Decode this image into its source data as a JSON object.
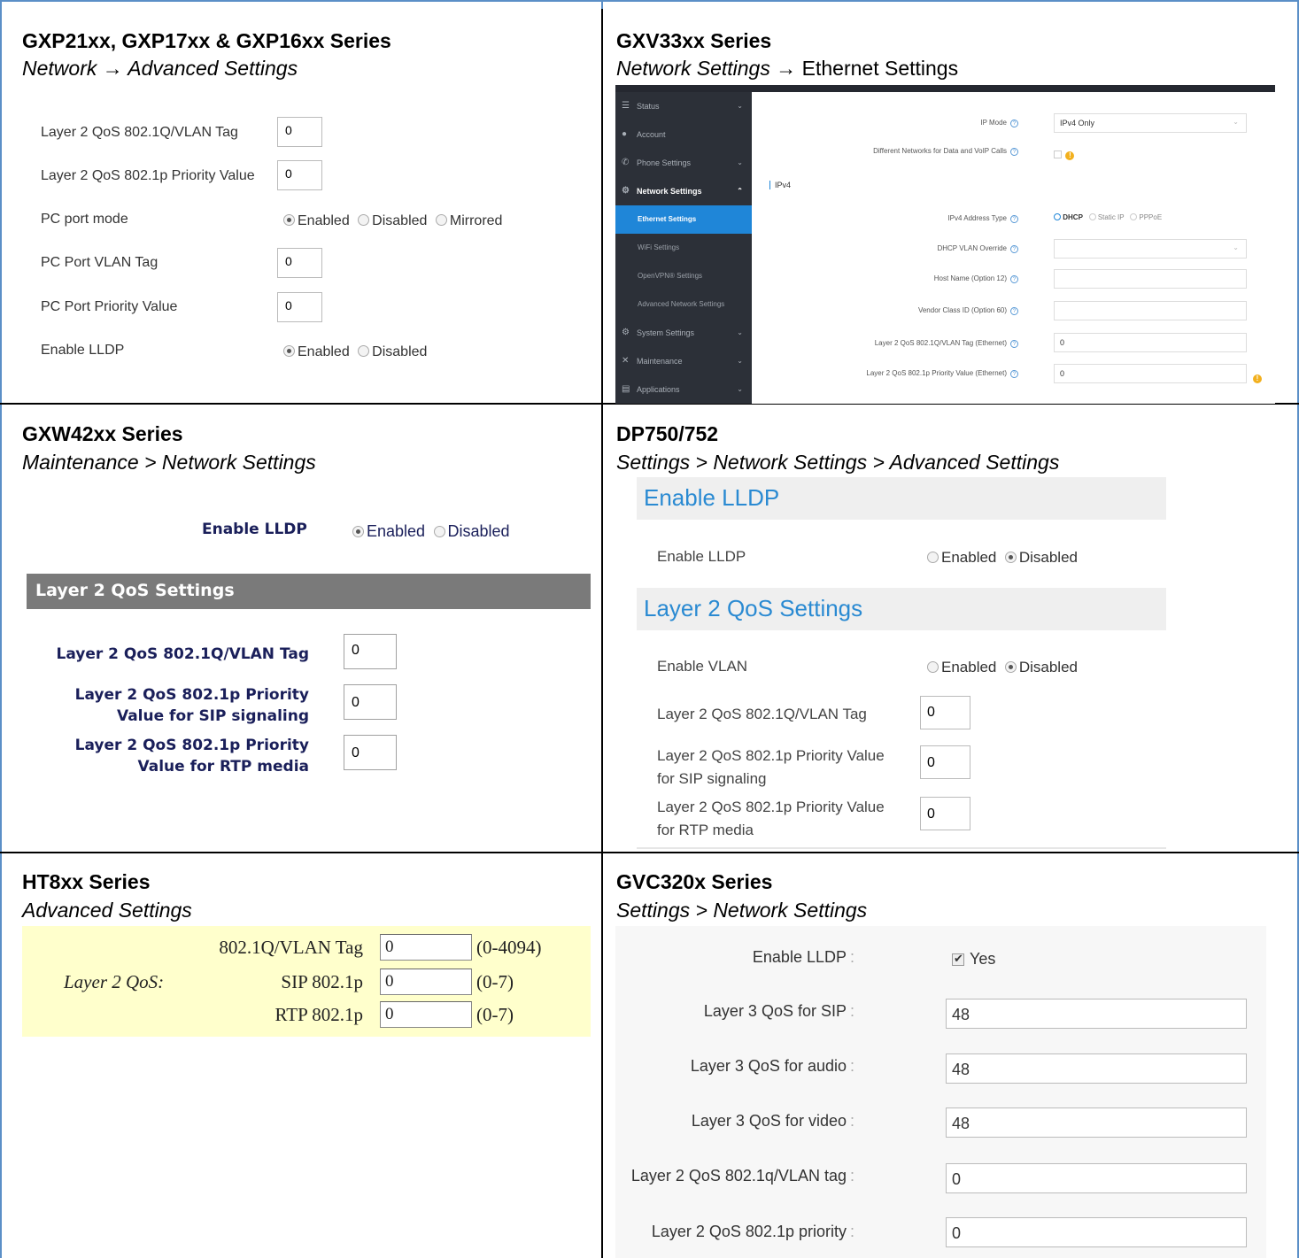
{
  "cells": {
    "gxp": {
      "title": "GXP21xx, GXP17xx & GXP16xx Series",
      "path": "Network → Advanced Settings",
      "rows": [
        {
          "label": "Layer 2 QoS 802.1Q/VLAN Tag",
          "value": "0"
        },
        {
          "label": "Layer 2 QoS 802.1p Priority Value",
          "value": "0"
        },
        {
          "label": "PC port mode",
          "options": [
            "Enabled",
            "Disabled",
            "Mirrored"
          ],
          "selected": "Enabled"
        },
        {
          "label": "PC Port VLAN Tag",
          "value": "0"
        },
        {
          "label": "PC Port Priority Value",
          "value": "0"
        },
        {
          "label": "Enable LLDP",
          "options": [
            "Enabled",
            "Disabled"
          ],
          "selected": "Enabled"
        }
      ]
    },
    "gxv": {
      "title": "GXV33xx Series",
      "path_italic": "Network Settings →",
      "path_plain": "Ethernet Settings",
      "sidebar": [
        {
          "label": "Status",
          "icon": "list-icon"
        },
        {
          "label": "Account",
          "icon": "user-icon"
        },
        {
          "label": "Phone Settings",
          "icon": "phone-icon"
        },
        {
          "label": "Network Settings",
          "icon": "network-icon"
        },
        {
          "label": "Ethernet Settings"
        },
        {
          "label": "WiFi Settings"
        },
        {
          "label": "OpenVPN® Settings"
        },
        {
          "label": "Advanced Network Settings"
        },
        {
          "label": "System Settings",
          "icon": "system-icon"
        },
        {
          "label": "Maintenance",
          "icon": "wrench-icon"
        },
        {
          "label": "Applications",
          "icon": "app-icon"
        }
      ],
      "ipv4_section": "IPv4",
      "fields": {
        "ip_mode_label": "IP Mode",
        "ip_mode_value": "IPv4 Only",
        "diff_networks_label": "Different Networks for Data and VoIP Calls",
        "ipv4_type_label": "IPv4 Address Type",
        "ipv4_type_options": [
          "DHCP",
          "Static IP",
          "PPPoE"
        ],
        "dhcp_vlan_label": "DHCP VLAN Override",
        "host_name_label": "Host Name (Option 12)",
        "vendor_class_label": "Vendor Class ID (Option 60)",
        "vlan_tag_label": "Layer 2 QoS 802.1Q/VLAN Tag (Ethernet)",
        "vlan_tag_value": "0",
        "priority_label": "Layer 2 QoS 802.1p Priority Value (Ethernet)",
        "priority_value": "0"
      }
    },
    "gxw": {
      "title": "GXW42xx Series",
      "path": "Maintenance > Network Settings",
      "lldp_label": "Enable LLDP",
      "lldp_options": [
        "Enabled",
        "Disabled"
      ],
      "section": "Layer 2 QoS Settings",
      "vlan_label": "Layer 2 QoS 802.1Q/VLAN Tag",
      "vlan_value": "0",
      "sip_label_1": "Layer 2 QoS 802.1p Priority",
      "sip_label_2": "Value for SIP signaling",
      "sip_value": "0",
      "rtp_label_1": "Layer 2 QoS 802.1p Priority",
      "rtp_label_2": "Value for RTP media",
      "rtp_value": "0"
    },
    "dp": {
      "title": "DP750/752",
      "path": "Settings > Network Settings > Advanced Settings",
      "section1": "Enable LLDP",
      "lldp_label": "Enable LLDP",
      "options": [
        "Enabled",
        "Disabled"
      ],
      "section2": "Layer 2 QoS Settings",
      "vlan_enable_label": "Enable VLAN",
      "vlan_tag_label": "Layer 2 QoS 802.1Q/VLAN Tag",
      "vlan_tag_value": "0",
      "sip_label_1": "Layer 2 QoS 802.1p Priority Value",
      "sip_label_2": "for SIP signaling",
      "sip_value": "0",
      "rtp_label_1": "Layer 2 QoS 802.1p Priority Value",
      "rtp_label_2": "for RTP media",
      "rtp_value": "0"
    },
    "ht": {
      "title": "HT8xx Series",
      "path": "Advanced Settings",
      "group_label": "Layer 2 QoS:",
      "rows": [
        {
          "label": "802.1Q/VLAN Tag",
          "value": "0",
          "range": "(0-4094)"
        },
        {
          "label": "SIP 802.1p",
          "value": "0",
          "range": "(0-7)"
        },
        {
          "label": "RTP 802.1p",
          "value": "0",
          "range": "(0-7)"
        }
      ]
    },
    "gvc": {
      "title": "GVC320x Series",
      "path": "Settings > Network Settings",
      "lldp_label": "Enable LLDP",
      "lldp_value": "Yes",
      "rows": [
        {
          "label": "Layer 3 QoS for SIP",
          "value": "48"
        },
        {
          "label": "Layer 3 QoS for audio",
          "value": "48"
        },
        {
          "label": "Layer 3 QoS for video",
          "value": "48"
        },
        {
          "label": "Layer 2 QoS 802.1q/VLAN tag",
          "value": "0"
        },
        {
          "label": "Layer 2 QoS 802.1p priority",
          "value": "0"
        }
      ]
    }
  },
  "colors": {
    "border": "#5b8fc7",
    "grid_line": "#000000",
    "navy_label": "#1a1f5a",
    "dp_heading": "#2a8ad2",
    "ht_bg": "#ffffcc"
  }
}
